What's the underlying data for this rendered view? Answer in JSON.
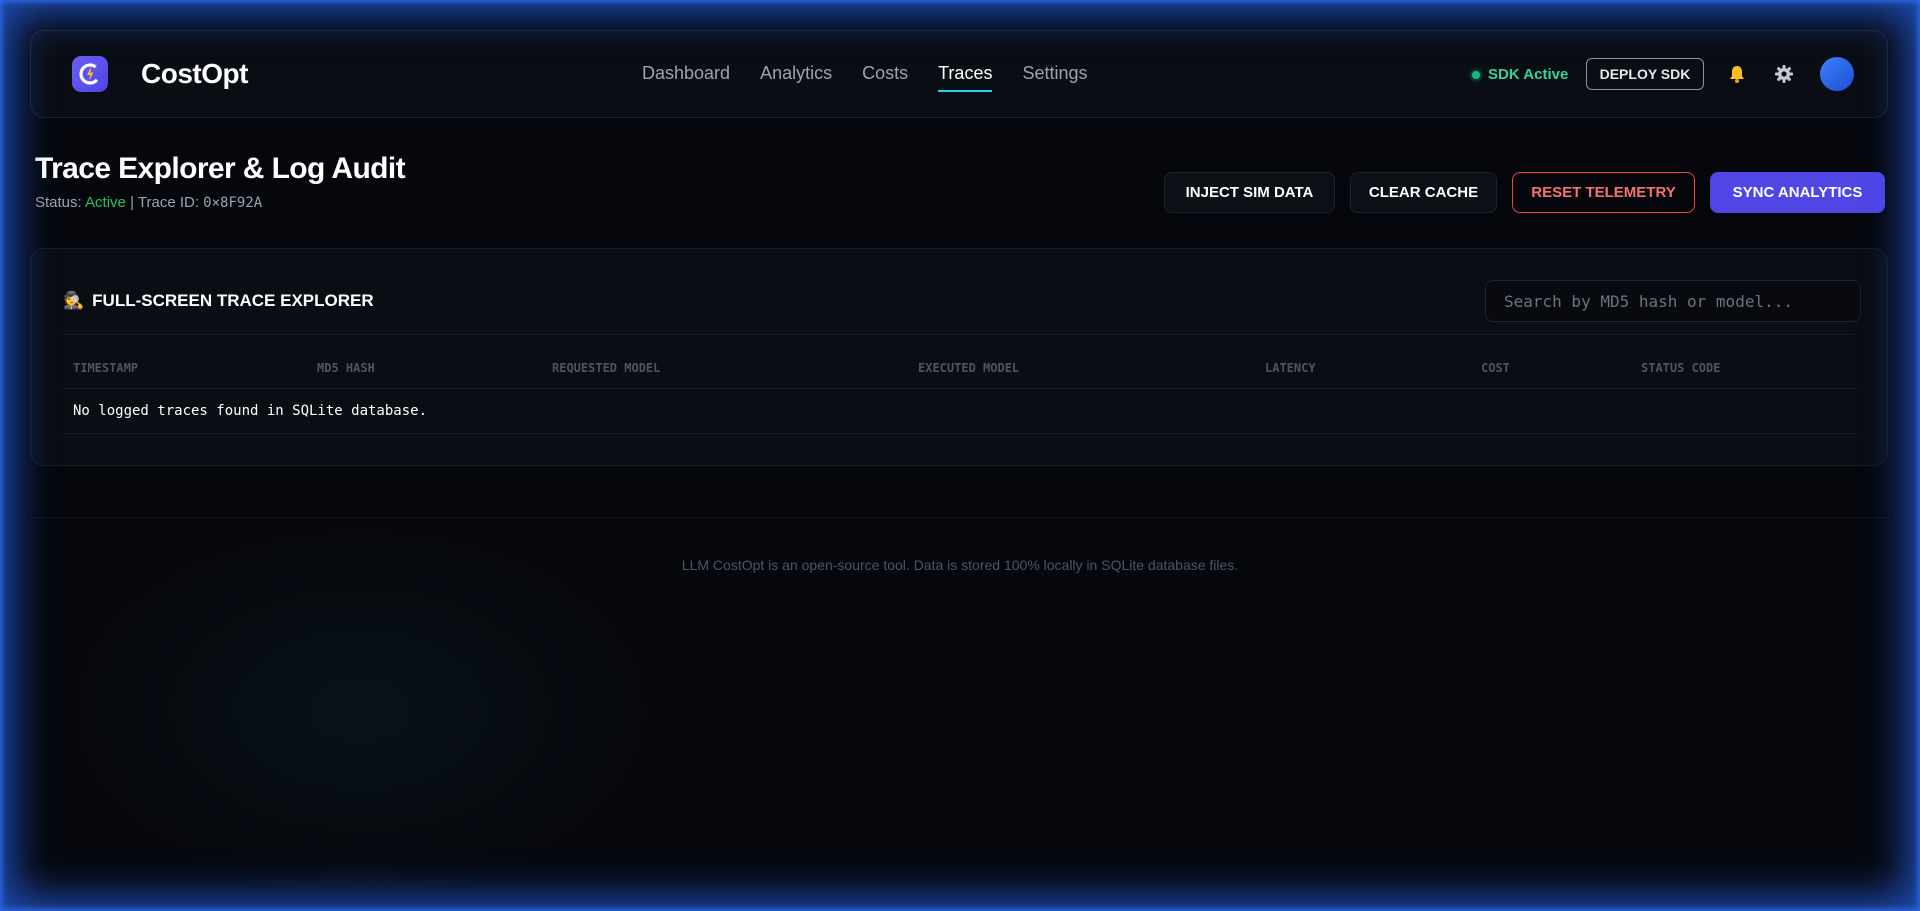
{
  "app": {
    "brand": "CostOpt",
    "nav": [
      {
        "label": "Dashboard",
        "active": false
      },
      {
        "label": "Analytics",
        "active": false
      },
      {
        "label": "Costs",
        "active": false
      },
      {
        "label": "Traces",
        "active": true
      },
      {
        "label": "Settings",
        "active": false
      }
    ],
    "sdk_status": "SDK Active",
    "deploy_label": "DEPLOY SDK",
    "icons": {
      "logo": "logo-icon",
      "bell": "bell-icon",
      "gear": "gear-icon",
      "avatar": "avatar"
    }
  },
  "page": {
    "title": "Trace Explorer & Log Audit",
    "status_label": "Status:",
    "status_value": "Active",
    "trace_label": "| Trace ID:",
    "trace_id": "0×8F92A",
    "actions": {
      "inject": "INJECT SIM DATA",
      "clear": "CLEAR CACHE",
      "reset": "RESET TELEMETRY",
      "sync": "SYNC ANALYTICS"
    }
  },
  "panel": {
    "icon": "🕵",
    "title": "FULL-SCREEN TRACE EXPLORER",
    "search_placeholder": "Search by MD5 hash or model...",
    "columns": [
      "TIMESTAMP",
      "MD5 HASH",
      "REQUESTED MODEL",
      "EXECUTED MODEL",
      "LATENCY",
      "COST",
      "STATUS CODE"
    ],
    "empty_message": "No logged traces found in SQLite database."
  },
  "footer": {
    "text": "LLM CostOpt is an open-source tool. Data is stored 100% locally in SQLite database files."
  },
  "colors": {
    "accent": "#4f46e5",
    "active_tab_underline": "#22d3ee",
    "success": "#22c55e",
    "danger": "#ef4444",
    "frame_glow": "#2563eb"
  }
}
